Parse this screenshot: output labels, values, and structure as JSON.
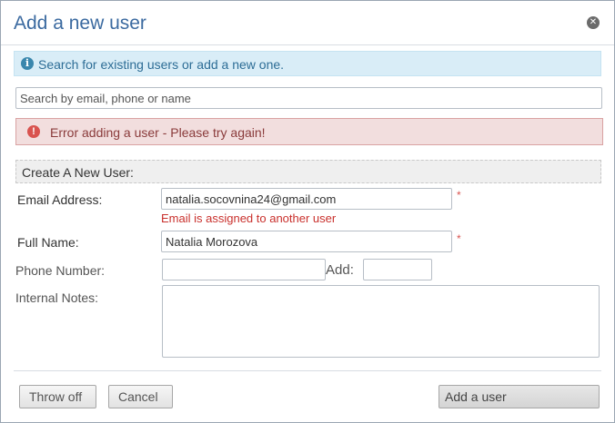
{
  "dialog": {
    "title": "Add a new user",
    "close_icon": "close-icon"
  },
  "info": {
    "icon": "info-icon",
    "text": "Search for existing users or add a new one."
  },
  "search": {
    "placeholder": "Search by email, phone or name",
    "value": ""
  },
  "error": {
    "icon": "error-icon",
    "text": "Error adding a user - Please try again!"
  },
  "form": {
    "section_title": "Create A New User:",
    "email_label": "Email Address:",
    "email_value": "natalia.socovnina24@gmail.com",
    "email_error": "Email is assigned to another user",
    "name_label": "Full Name:",
    "name_value": "Natalia Morozova",
    "phone_label": "Phone Number:",
    "phone_value": "",
    "add_label": "Add:",
    "add_value": "",
    "notes_label": "Internal Notes:",
    "notes_value": "",
    "required_mark": "*"
  },
  "buttons": {
    "throw_off": "Throw off",
    "cancel": "Cancel",
    "add_user": "Add a user"
  },
  "colors": {
    "title": "#3b6aa0",
    "info_bg": "#d9edf7",
    "error_bg": "#f2dede",
    "error_text": "#c9302c"
  }
}
